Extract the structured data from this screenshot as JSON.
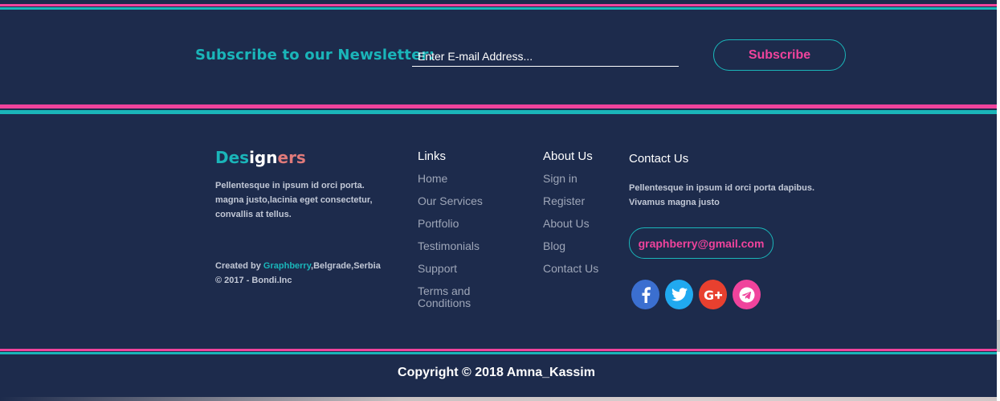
{
  "newsletter": {
    "label": "Subscribe to our Newsletter:",
    "email_placeholder": "Enter E-mail Address...",
    "subscribe_label": "Subscribe"
  },
  "brand": {
    "part1": "Des",
    "part2": "ign",
    "part3": "ers",
    "description": "Pellentesque in ipsum id orci porta. magna justo,lacinia eget consectetur, convallis at tellus.",
    "credit_prefix": "Created by ",
    "credit_link": "Graphberry",
    "credit_suffix": ",Belgrade,Serbia",
    "copyright_line": "© 2017 - Bondi.Inc"
  },
  "links": {
    "title": "Links",
    "items": [
      "Home",
      "Our Services",
      "Portfolio",
      "Testimonials",
      "Support",
      "Terms and Conditions"
    ]
  },
  "about": {
    "title": "About Us",
    "items": [
      "Sign in",
      "Register",
      "About Us",
      "Blog",
      "Contact Us"
    ]
  },
  "contact": {
    "title": "Contact Us",
    "description": "Pellentesque in ipsum id orci porta dapibus. Vivamus magna justo",
    "email": "graphberry@gmail.com",
    "social": [
      "facebook-icon",
      "twitter-icon",
      "google-plus-icon",
      "telegram-icon"
    ]
  },
  "footer": {
    "copyright": "Copyright © 2018 Amna_Kassim"
  },
  "colors": {
    "background": "#1d2b4c",
    "accent_teal": "#1ab5b9",
    "accent_pink": "#f0439c"
  }
}
